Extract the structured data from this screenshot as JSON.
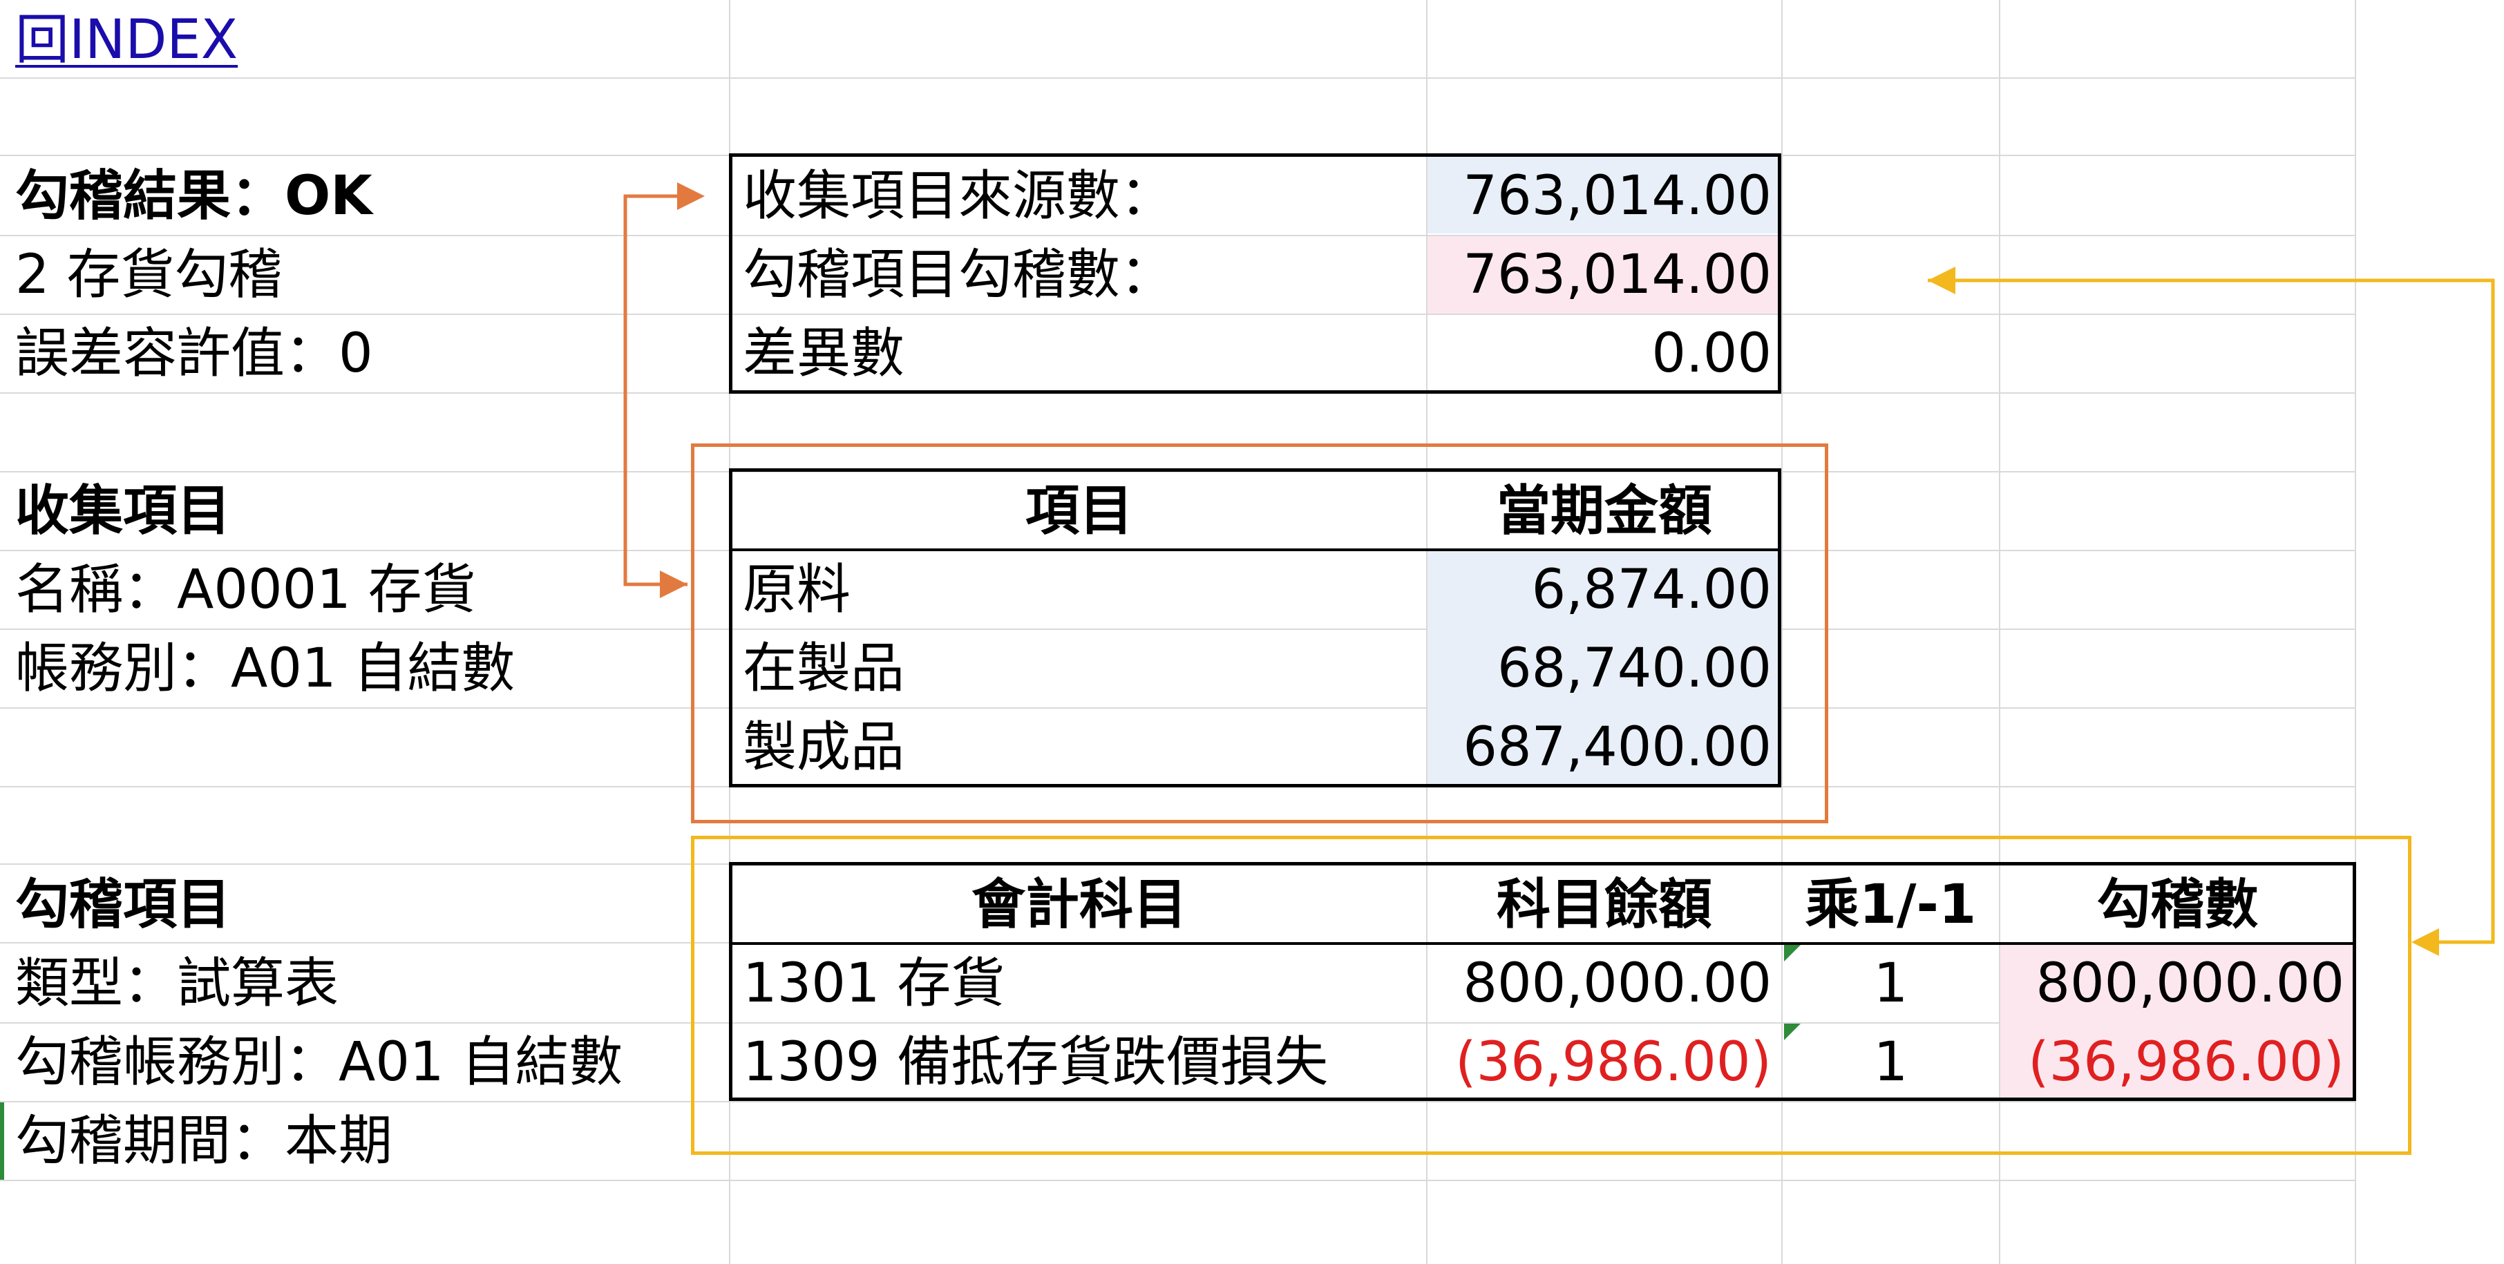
{
  "index_link": "回INDEX",
  "left": {
    "result_line": "勾稽結果：OK",
    "check_name": "2 存貨勾稽",
    "tolerance": "誤差容許值：0",
    "collect_title": "收集項目",
    "collect_name": "名稱：A0001 存貨",
    "collect_book": "帳務別：A01 自結數",
    "check_title": "勾稽項目",
    "check_type": "類型：試算表",
    "check_book": "勾稽帳務別：A01 自結數",
    "check_period": "勾稽期間：本期"
  },
  "summary": {
    "rows": [
      {
        "label": "收集項目來源數：",
        "value": "763,014.00"
      },
      {
        "label": "勾稽項目勾稽數：",
        "value": "763,014.00"
      },
      {
        "label": "差異數",
        "value": "0.00"
      }
    ]
  },
  "collect_table": {
    "headers": {
      "item": "項目",
      "amount": "當期金額"
    },
    "rows": [
      {
        "item": "原料",
        "amount": "6,874.00"
      },
      {
        "item": "在製品",
        "amount": "68,740.00"
      },
      {
        "item": "製成品",
        "amount": "687,400.00"
      }
    ]
  },
  "check_table": {
    "headers": {
      "account": "會計科目",
      "balance": "科目餘額",
      "multiplier": "乘1/-1",
      "checked": "勾稽數"
    },
    "rows": [
      {
        "account": "1301 存貨",
        "balance": "800,000.00",
        "multiplier": "1",
        "checked": "800,000.00"
      },
      {
        "account": "1309 備抵存貨跌價損失",
        "balance": "(36,986.00)",
        "multiplier": "1",
        "checked": "(36,986.00)"
      }
    ]
  },
  "colors": {
    "orange_callout": "#e27a3f",
    "yellow_callout": "#f2b81d",
    "negative_text": "#e02020",
    "source_fill": "#e8eff8",
    "check_fill": "#fde7ef",
    "link": "#1a0dab"
  }
}
